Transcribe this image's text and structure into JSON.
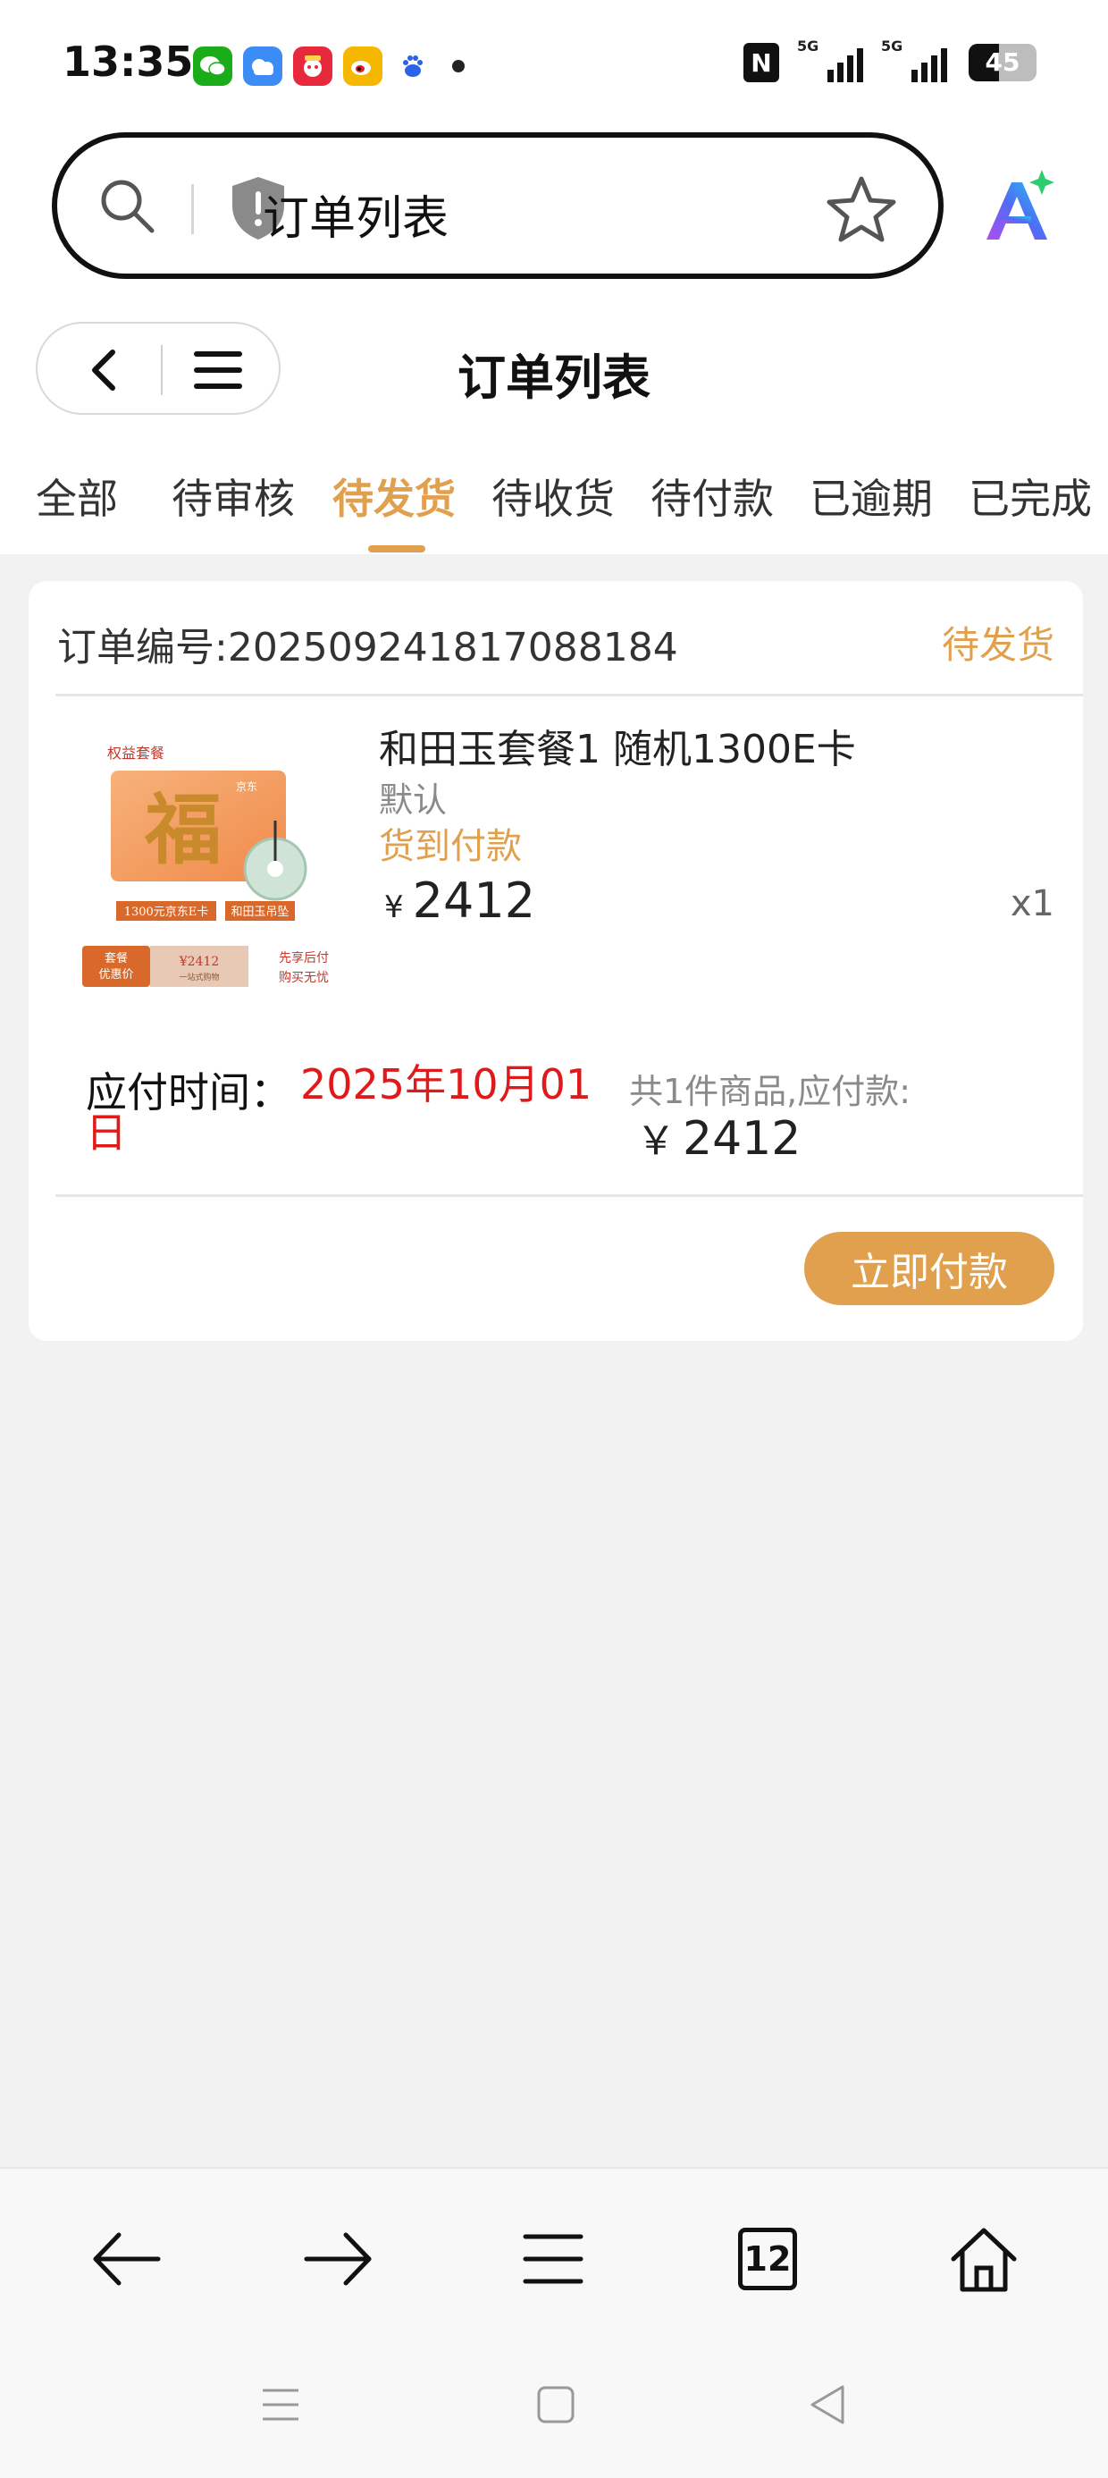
{
  "status_bar": {
    "time": "13:35",
    "apps": [
      {
        "icon": "wechat-icon",
        "color": "#1aad19",
        "glyph": "✉"
      },
      {
        "icon": "weather-icon",
        "color": "#3b8cf5",
        "glyph": "☁"
      },
      {
        "icon": "pinduoduo-icon",
        "color": "#e8283c",
        "glyph": "拼"
      },
      {
        "icon": "weibo-icon",
        "color": "#f5b700",
        "glyph": "微"
      },
      {
        "icon": "baidu-icon",
        "color": "#ffffff",
        "glyph": "du"
      }
    ],
    "network_1": "5G",
    "network_2": "5G",
    "battery": "45",
    "battery_level": 0.45
  },
  "address_bar": {
    "title": "订单列表"
  },
  "header": {
    "title": "订单列表"
  },
  "tabs": [
    {
      "label": "全部",
      "active": false
    },
    {
      "label": "待审核",
      "active": false
    },
    {
      "label": "待发货",
      "active": true
    },
    {
      "label": "待收货",
      "active": false
    },
    {
      "label": "待付款",
      "active": false
    },
    {
      "label": "已逾期",
      "active": false
    },
    {
      "label": "已完成",
      "active": false
    }
  ],
  "order": {
    "number": "订单编号:202509241817088184",
    "status": "待发货",
    "product": {
      "name": "和田玉套餐1 随机1300E卡",
      "spec": "默认",
      "pay_method": "货到付款",
      "currency": "¥",
      "price": "2412",
      "quantity": "x1",
      "image": {
        "title": "权益套餐",
        "card_text": "福",
        "card_brand": "京东",
        "tag_left": "1300元京东E卡",
        "tag_right": "和田玉吊坠",
        "promo_label": "套餐\n优惠价",
        "promo_price": "¥2412",
        "promo_sub": "一站式购物",
        "promo_right": "先享后付\n购买无忧"
      }
    },
    "due_label": "应付时间：",
    "due_date": "2025年10月01日",
    "summary_label": "共1件商品,应付款:",
    "summary_currency": "￥",
    "summary_price": "2412",
    "pay_button": "立即付款"
  },
  "toolbar": {
    "tab_count": "12"
  },
  "colors": {
    "accent": "#e0a04e",
    "due_red": "#e01a1a",
    "background": "#f2f2f2"
  }
}
